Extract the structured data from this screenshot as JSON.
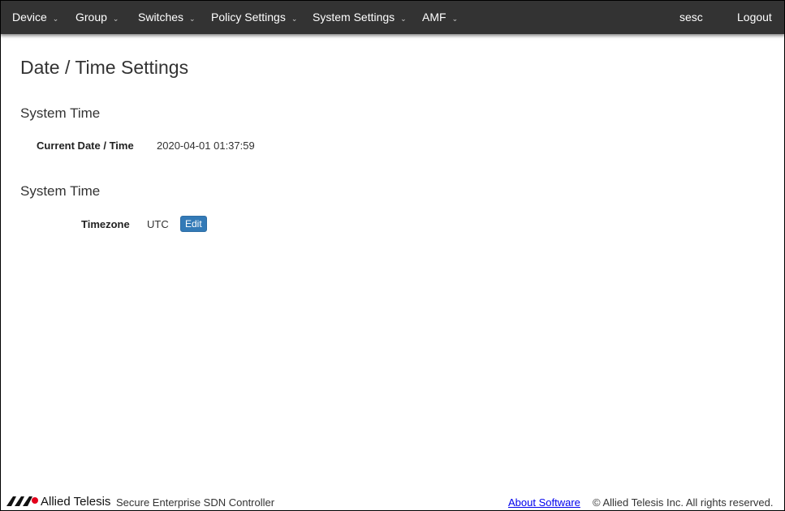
{
  "nav": {
    "items": [
      "Device",
      "Group",
      "Switches",
      "Policy Settings",
      "System Settings",
      "AMF"
    ],
    "user": "sesc",
    "logout": "Logout"
  },
  "page_title": "Date / Time Settings",
  "section1": {
    "title": "System Time",
    "label": "Current Date / Time",
    "value": "2020-04-01 01:37:59"
  },
  "section2": {
    "title": "System Time",
    "label": "Timezone",
    "value": "UTC",
    "edit": "Edit"
  },
  "footer": {
    "logo_text": "Allied Telesis",
    "product": "Secure Enterprise SDN Controller",
    "about": "About Software",
    "copyright": "© Allied Telesis Inc. All rights reserved."
  }
}
